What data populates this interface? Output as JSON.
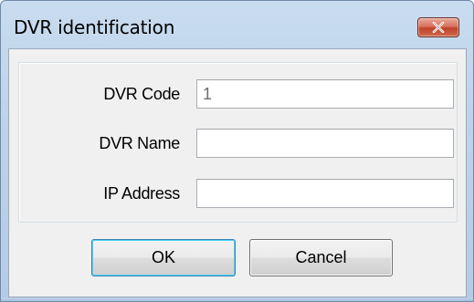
{
  "window": {
    "title": "DVR identification"
  },
  "title_bar": {
    "close_icon": "close-x-icon"
  },
  "form": {
    "fields": [
      {
        "label": "DVR Code",
        "value": "1",
        "placeholder": ""
      },
      {
        "label": "DVR Name",
        "value": "",
        "placeholder": ""
      },
      {
        "label": "IP Address",
        "value": "",
        "placeholder": ""
      }
    ]
  },
  "buttons": {
    "ok_label": "OK",
    "cancel_label": "Cancel"
  },
  "colors": {
    "frame": "#bdd3ea",
    "client": "#f0f0f0",
    "close_button": "#c0412a",
    "default_button_border": "#3c7fb1"
  }
}
